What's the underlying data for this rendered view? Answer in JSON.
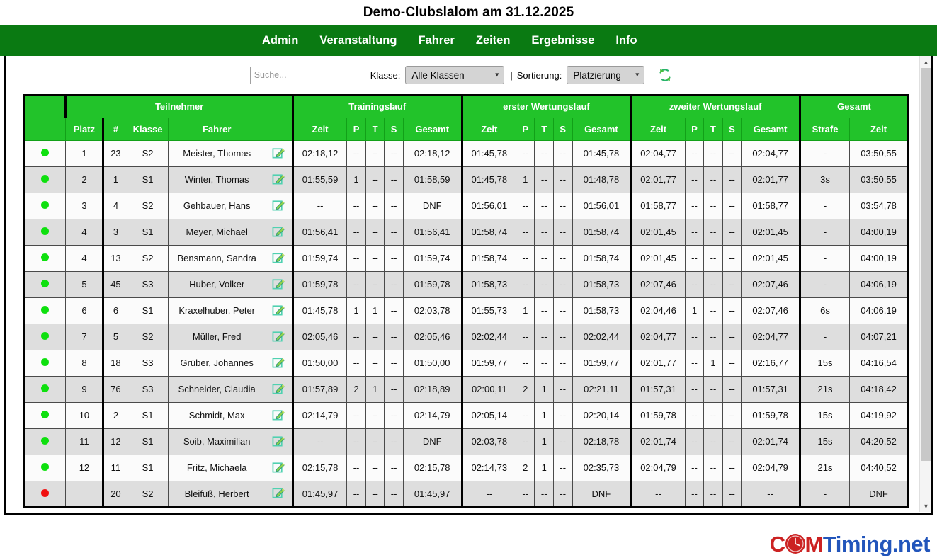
{
  "header": {
    "title": "Demo-Clubslalom am 31.12.2025"
  },
  "nav": {
    "items": [
      {
        "label": "Admin"
      },
      {
        "label": "Veranstaltung"
      },
      {
        "label": "Fahrer"
      },
      {
        "label": "Zeiten"
      },
      {
        "label": "Ergebnisse"
      },
      {
        "label": "Info"
      }
    ]
  },
  "filterbar": {
    "search_placeholder": "Suche...",
    "search_value": "",
    "klasse_label": "Klasse:",
    "klasse_value": "Alle Klassen",
    "separator": "|",
    "sortierung_label": "Sortierung:",
    "sortierung_value": "Platzierung",
    "refresh_icon": "refresh-icon",
    "caret_icon": "chevron-down-icon"
  },
  "table": {
    "group_headers": [
      {
        "label": "",
        "span": 1
      },
      {
        "label": "Teilnehmer",
        "span": 5
      },
      {
        "label": "Trainingslauf",
        "span": 5
      },
      {
        "label": "erster Wertungslauf",
        "span": 5
      },
      {
        "label": "zweiter Wertungslauf",
        "span": 5
      },
      {
        "label": "Gesamt",
        "span": 2
      }
    ],
    "columns": [
      "",
      "Platz",
      "#",
      "Klasse",
      "Fahrer",
      "",
      "Zeit",
      "P",
      "T",
      "S",
      "Gesamt",
      "Zeit",
      "P",
      "T",
      "S",
      "Gesamt",
      "Zeit",
      "P",
      "T",
      "S",
      "Gesamt",
      "Strafe",
      "Zeit"
    ],
    "rows": [
      {
        "status": "green",
        "platz": "1",
        "nr": "23",
        "klasse": "S2",
        "fahrer": "Meister, Thomas",
        "tr": {
          "zeit": "02:18,12",
          "p": "--",
          "t": "--",
          "s": "--",
          "ges": "02:18,12"
        },
        "w1": {
          "zeit": "01:45,78",
          "p": "--",
          "t": "--",
          "s": "--",
          "ges": "01:45,78"
        },
        "w2": {
          "zeit": "02:04,77",
          "p": "--",
          "t": "--",
          "s": "--",
          "ges": "02:04,77"
        },
        "strafe": "-",
        "gesamt": "03:50,55"
      },
      {
        "status": "green",
        "platz": "2",
        "nr": "1",
        "klasse": "S1",
        "fahrer": "Winter, Thomas",
        "tr": {
          "zeit": "01:55,59",
          "p": "1",
          "t": "--",
          "s": "--",
          "ges": "01:58,59"
        },
        "w1": {
          "zeit": "01:45,78",
          "p": "1",
          "t": "--",
          "s": "--",
          "ges": "01:48,78"
        },
        "w2": {
          "zeit": "02:01,77",
          "p": "--",
          "t": "--",
          "s": "--",
          "ges": "02:01,77"
        },
        "strafe": "3s",
        "gesamt": "03:50,55"
      },
      {
        "status": "green",
        "platz": "3",
        "nr": "4",
        "klasse": "S2",
        "fahrer": "Gehbauer, Hans",
        "tr": {
          "zeit": "--",
          "p": "--",
          "t": "--",
          "s": "--",
          "ges": "DNF"
        },
        "w1": {
          "zeit": "01:56,01",
          "p": "--",
          "t": "--",
          "s": "--",
          "ges": "01:56,01"
        },
        "w2": {
          "zeit": "01:58,77",
          "p": "--",
          "t": "--",
          "s": "--",
          "ges": "01:58,77"
        },
        "strafe": "-",
        "gesamt": "03:54,78"
      },
      {
        "status": "green",
        "platz": "4",
        "nr": "3",
        "klasse": "S1",
        "fahrer": "Meyer, Michael",
        "tr": {
          "zeit": "01:56,41",
          "p": "--",
          "t": "--",
          "s": "--",
          "ges": "01:56,41"
        },
        "w1": {
          "zeit": "01:58,74",
          "p": "--",
          "t": "--",
          "s": "--",
          "ges": "01:58,74"
        },
        "w2": {
          "zeit": "02:01,45",
          "p": "--",
          "t": "--",
          "s": "--",
          "ges": "02:01,45"
        },
        "strafe": "-",
        "gesamt": "04:00,19"
      },
      {
        "status": "green",
        "platz": "4",
        "nr": "13",
        "klasse": "S2",
        "fahrer": "Bensmann, Sandra",
        "tr": {
          "zeit": "01:59,74",
          "p": "--",
          "t": "--",
          "s": "--",
          "ges": "01:59,74"
        },
        "w1": {
          "zeit": "01:58,74",
          "p": "--",
          "t": "--",
          "s": "--",
          "ges": "01:58,74"
        },
        "w2": {
          "zeit": "02:01,45",
          "p": "--",
          "t": "--",
          "s": "--",
          "ges": "02:01,45"
        },
        "strafe": "-",
        "gesamt": "04:00,19"
      },
      {
        "status": "green",
        "platz": "5",
        "nr": "45",
        "klasse": "S3",
        "fahrer": "Huber, Volker",
        "tr": {
          "zeit": "01:59,78",
          "p": "--",
          "t": "--",
          "s": "--",
          "ges": "01:59,78"
        },
        "w1": {
          "zeit": "01:58,73",
          "p": "--",
          "t": "--",
          "s": "--",
          "ges": "01:58,73"
        },
        "w2": {
          "zeit": "02:07,46",
          "p": "--",
          "t": "--",
          "s": "--",
          "ges": "02:07,46"
        },
        "strafe": "-",
        "gesamt": "04:06,19"
      },
      {
        "status": "green",
        "platz": "6",
        "nr": "6",
        "klasse": "S1",
        "fahrer": "Kraxelhuber, Peter",
        "tr": {
          "zeit": "01:45,78",
          "p": "1",
          "t": "1",
          "s": "--",
          "ges": "02:03,78"
        },
        "w1": {
          "zeit": "01:55,73",
          "p": "1",
          "t": "--",
          "s": "--",
          "ges": "01:58,73"
        },
        "w2": {
          "zeit": "02:04,46",
          "p": "1",
          "t": "--",
          "s": "--",
          "ges": "02:07,46"
        },
        "strafe": "6s",
        "gesamt": "04:06,19"
      },
      {
        "status": "green",
        "platz": "7",
        "nr": "5",
        "klasse": "S2",
        "fahrer": "Müller, Fred",
        "tr": {
          "zeit": "02:05,46",
          "p": "--",
          "t": "--",
          "s": "--",
          "ges": "02:05,46"
        },
        "w1": {
          "zeit": "02:02,44",
          "p": "--",
          "t": "--",
          "s": "--",
          "ges": "02:02,44"
        },
        "w2": {
          "zeit": "02:04,77",
          "p": "--",
          "t": "--",
          "s": "--",
          "ges": "02:04,77"
        },
        "strafe": "-",
        "gesamt": "04:07,21"
      },
      {
        "status": "green",
        "platz": "8",
        "nr": "18",
        "klasse": "S3",
        "fahrer": "Grüber, Johannes",
        "tr": {
          "zeit": "01:50,00",
          "p": "--",
          "t": "--",
          "s": "--",
          "ges": "01:50,00"
        },
        "w1": {
          "zeit": "01:59,77",
          "p": "--",
          "t": "--",
          "s": "--",
          "ges": "01:59,77"
        },
        "w2": {
          "zeit": "02:01,77",
          "p": "--",
          "t": "1",
          "s": "--",
          "ges": "02:16,77"
        },
        "strafe": "15s",
        "gesamt": "04:16,54"
      },
      {
        "status": "green",
        "platz": "9",
        "nr": "76",
        "klasse": "S3",
        "fahrer": "Schneider, Claudia",
        "tr": {
          "zeit": "01:57,89",
          "p": "2",
          "t": "1",
          "s": "--",
          "ges": "02:18,89"
        },
        "w1": {
          "zeit": "02:00,11",
          "p": "2",
          "t": "1",
          "s": "--",
          "ges": "02:21,11"
        },
        "w2": {
          "zeit": "01:57,31",
          "p": "--",
          "t": "--",
          "s": "--",
          "ges": "01:57,31"
        },
        "strafe": "21s",
        "gesamt": "04:18,42"
      },
      {
        "status": "green",
        "platz": "10",
        "nr": "2",
        "klasse": "S1",
        "fahrer": "Schmidt, Max",
        "tr": {
          "zeit": "02:14,79",
          "p": "--",
          "t": "--",
          "s": "--",
          "ges": "02:14,79"
        },
        "w1": {
          "zeit": "02:05,14",
          "p": "--",
          "t": "1",
          "s": "--",
          "ges": "02:20,14"
        },
        "w2": {
          "zeit": "01:59,78",
          "p": "--",
          "t": "--",
          "s": "--",
          "ges": "01:59,78"
        },
        "strafe": "15s",
        "gesamt": "04:19,92"
      },
      {
        "status": "green",
        "platz": "11",
        "nr": "12",
        "klasse": "S1",
        "fahrer": "Soib, Maximilian",
        "tr": {
          "zeit": "--",
          "p": "--",
          "t": "--",
          "s": "--",
          "ges": "DNF"
        },
        "w1": {
          "zeit": "02:03,78",
          "p": "--",
          "t": "1",
          "s": "--",
          "ges": "02:18,78"
        },
        "w2": {
          "zeit": "02:01,74",
          "p": "--",
          "t": "--",
          "s": "--",
          "ges": "02:01,74"
        },
        "strafe": "15s",
        "gesamt": "04:20,52"
      },
      {
        "status": "green",
        "platz": "12",
        "nr": "11",
        "klasse": "S1",
        "fahrer": "Fritz, Michaela",
        "tr": {
          "zeit": "02:15,78",
          "p": "--",
          "t": "--",
          "s": "--",
          "ges": "02:15,78"
        },
        "w1": {
          "zeit": "02:14,73",
          "p": "2",
          "t": "1",
          "s": "--",
          "ges": "02:35,73"
        },
        "w2": {
          "zeit": "02:04,79",
          "p": "--",
          "t": "--",
          "s": "--",
          "ges": "02:04,79"
        },
        "strafe": "21s",
        "gesamt": "04:40,52"
      },
      {
        "status": "red",
        "platz": "",
        "nr": "20",
        "klasse": "S2",
        "fahrer": "Bleifuß, Herbert",
        "tr": {
          "zeit": "01:45,97",
          "p": "--",
          "t": "--",
          "s": "--",
          "ges": "01:45,97"
        },
        "w1": {
          "zeit": "--",
          "p": "--",
          "t": "--",
          "s": "--",
          "ges": "DNF"
        },
        "w2": {
          "zeit": "--",
          "p": "--",
          "t": "--",
          "s": "--",
          "ges": "--"
        },
        "strafe": "-",
        "gesamt": "DNF"
      }
    ]
  },
  "footer": {
    "logo_part1": "C",
    "logo_part2": "M",
    "logo_part3": "Timing.net",
    "clock_icon": "clock-icon"
  },
  "scrollbar": {
    "up_icon": "chevron-up-icon",
    "down_icon": "chevron-down-icon"
  },
  "colors": {
    "nav_green": "#0a7a12",
    "header_green": "#22c32a",
    "status_ok": "#0ee00e",
    "status_dnf": "#f01010",
    "logo_red": "#cc2222",
    "logo_blue": "#2255bb"
  }
}
